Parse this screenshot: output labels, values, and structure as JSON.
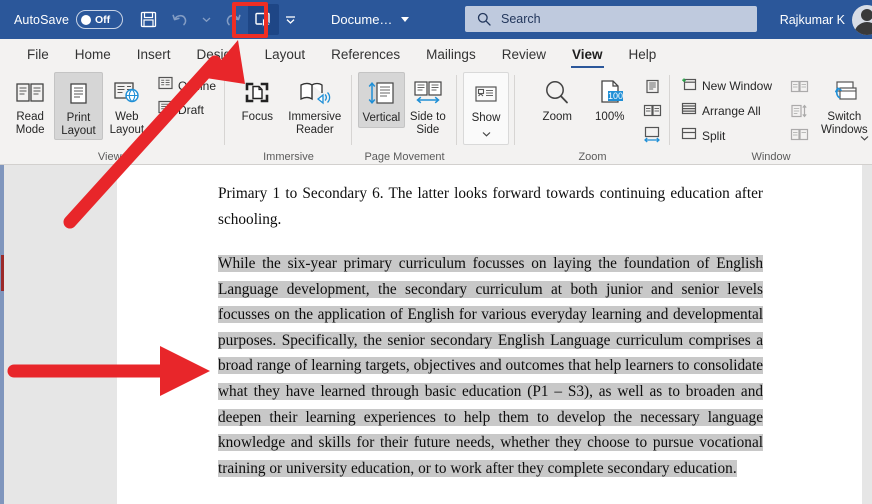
{
  "titlebar": {
    "autosave_label": "AutoSave",
    "autosave_state": "Off",
    "document_name": "Docume…",
    "user_name": "Rajkumar K",
    "accent_color": "#2b579a",
    "qat": [
      {
        "name": "save-icon",
        "label": "Save"
      },
      {
        "name": "undo-icon",
        "label": "Undo"
      },
      {
        "name": "redo-icon",
        "label": "Redo"
      },
      {
        "name": "touch-mouse-mode-icon",
        "label": "Touch/Mouse Mode"
      },
      {
        "name": "customize-quick-access-toolbar-icon",
        "label": "Customize Quick Access Toolbar"
      }
    ]
  },
  "search": {
    "placeholder": "Search",
    "value": "",
    "icon": "search-icon"
  },
  "tabs": [
    {
      "label": "File",
      "active": false
    },
    {
      "label": "Home",
      "active": false
    },
    {
      "label": "Insert",
      "active": false
    },
    {
      "label": "Design",
      "active": false
    },
    {
      "label": "Layout",
      "active": false
    },
    {
      "label": "References",
      "active": false
    },
    {
      "label": "Mailings",
      "active": false
    },
    {
      "label": "Review",
      "active": false
    },
    {
      "label": "View",
      "active": true
    },
    {
      "label": "Help",
      "active": false
    }
  ],
  "ribbon": {
    "groups": [
      {
        "name": "views",
        "label": "Views",
        "buttons": [
          {
            "label": "Read Mode",
            "icon": "read-mode-icon",
            "selected": false
          },
          {
            "label": "Print Layout",
            "icon": "print-layout-icon",
            "selected": true
          },
          {
            "label": "Web Layout",
            "icon": "web-layout-icon",
            "selected": false
          }
        ],
        "small_buttons": [
          {
            "label": "Outline",
            "icon": "outline-view-icon"
          },
          {
            "label": "Draft",
            "icon": "draft-view-icon"
          }
        ]
      },
      {
        "name": "immersive",
        "label": "Immersive",
        "buttons": [
          {
            "label": "Focus",
            "icon": "focus-mode-icon",
            "selected": false
          },
          {
            "label": "Immersive Reader",
            "icon": "immersive-reader-icon",
            "selected": false
          }
        ]
      },
      {
        "name": "page-movement",
        "label": "Page Movement",
        "buttons": [
          {
            "label": "Vertical",
            "icon": "vertical-scroll-icon",
            "selected": true
          },
          {
            "label": "Side to Side",
            "icon": "side-to-side-icon",
            "selected": false
          }
        ]
      },
      {
        "name": "show",
        "label": "",
        "buttons": [
          {
            "label": "Show",
            "icon": "show-panel-icon",
            "selected": false
          }
        ]
      },
      {
        "name": "zoom",
        "label": "Zoom",
        "buttons": [
          {
            "label": "Zoom",
            "icon": "zoom-magnifier-icon",
            "selected": false
          },
          {
            "label": "100%",
            "icon": "zoom-100-icon",
            "selected": false
          }
        ],
        "icon_buttons": [
          {
            "label": "One Page",
            "icon": "one-page-icon"
          },
          {
            "label": "Multiple Pages",
            "icon": "multiple-pages-icon"
          },
          {
            "label": "Page Width",
            "icon": "page-width-icon"
          }
        ]
      },
      {
        "name": "window",
        "label": "Window",
        "small_buttons": [
          {
            "label": "New Window",
            "icon": "new-window-icon"
          },
          {
            "label": "Arrange All",
            "icon": "arrange-all-icon"
          },
          {
            "label": "Split",
            "icon": "split-window-icon"
          }
        ],
        "icon_buttons": [
          {
            "label": "View Side by Side",
            "icon": "view-side-by-side-icon"
          },
          {
            "label": "Synchronous Scrolling",
            "icon": "synchronous-scrolling-icon"
          },
          {
            "label": "Reset Window Position",
            "icon": "reset-window-position-icon"
          }
        ],
        "buttons": [
          {
            "label": "Switch Windows",
            "icon": "switch-windows-icon",
            "selected": false
          }
        ]
      }
    ]
  },
  "document": {
    "paragraph_1": "Primary 1 to Secondary 6. The latter looks forward towards continuing education after schooling.",
    "paragraph_2_highlighted": "While the six-year primary curriculum focusses on laying the foundation of English Language development, the secondary curriculum at both junior and senior levels focusses on the application of English for various everyday learning and developmental purposes. Specifically, the senior secondary English Language curriculum comprises a broad range of learning targets, objectives and outcomes that help learners to consolidate what they have learned through basic education (P1 – S3), as well as to broaden and deepen their learning experiences to help them to develop the necessary language knowledge and skills for their future needs, whether they choose to pursue vocational training or university education, or to work after they complete secondary education.",
    "highlight_color": "#c8c8c8"
  },
  "annotations": {
    "arrow_color": "#e8262a",
    "highlight_box_color": "#ee2e24",
    "items": [
      {
        "name": "arrow-to-touch-mode-button"
      },
      {
        "name": "arrow-to-selected-text"
      },
      {
        "name": "highlight-box-touch-mode-button"
      }
    ]
  }
}
